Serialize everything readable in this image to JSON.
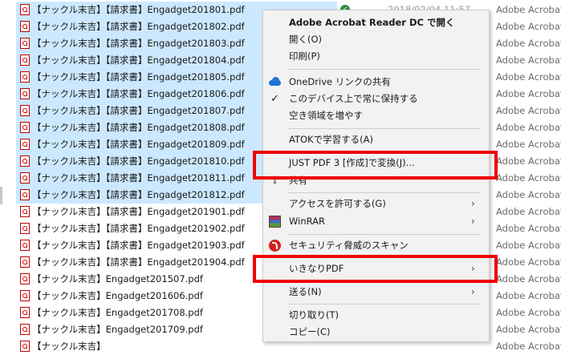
{
  "files": [
    {
      "name": "【ナックル末吉】【請求書】Engadget201801.pdf",
      "selected": true,
      "date": "2018/02/04 11:57",
      "synced": true,
      "type": "Adobe Acrobat D..."
    },
    {
      "name": "【ナックル末吉】【請求書】Engadget201802.pdf",
      "selected": true,
      "type": "Adobe Acrobat D..."
    },
    {
      "name": "【ナックル末吉】【請求書】Engadget201803.pdf",
      "selected": true,
      "type": "Adobe Acrobat D..."
    },
    {
      "name": "【ナックル末吉】【請求書】Engadget201804.pdf",
      "selected": true,
      "type": "Adobe Acrobat D..."
    },
    {
      "name": "【ナックル末吉】【請求書】Engadget201805.pdf",
      "selected": true,
      "type": "Adobe Acrobat D..."
    },
    {
      "name": "【ナックル末吉】【請求書】Engadget201806.pdf",
      "selected": true,
      "type": "Adobe Acrobat D..."
    },
    {
      "name": "【ナックル末吉】【請求書】Engadget201807.pdf",
      "selected": true,
      "type": "Adobe Acrobat D..."
    },
    {
      "name": "【ナックル末吉】【請求書】Engadget201808.pdf",
      "selected": true,
      "type": "Adobe Acrobat D..."
    },
    {
      "name": "【ナックル末吉】【請求書】Engadget201809.pdf",
      "selected": true,
      "type": "Adobe Acrobat D..."
    },
    {
      "name": "【ナックル末吉】【請求書】Engadget201810.pdf",
      "selected": true,
      "type": "Adobe Acrobat D..."
    },
    {
      "name": "【ナックル末吉】【請求書】Engadget201811.pdf",
      "selected": true,
      "type": "Adobe Acrobat D..."
    },
    {
      "name": "【ナックル末吉】【請求書】Engadget201812.pdf",
      "selected": true,
      "type": "Adobe Acrobat D..."
    },
    {
      "name": "【ナックル末吉】【請求書】Engadget201901.pdf",
      "selected": false,
      "type": "Adobe Acrobat D..."
    },
    {
      "name": "【ナックル末吉】【請求書】Engadget201902.pdf",
      "selected": false,
      "type": "Adobe Acrobat D..."
    },
    {
      "name": "【ナックル末吉】【請求書】Engadget201903.pdf",
      "selected": false,
      "type": "Adobe Acrobat D..."
    },
    {
      "name": "【ナックル末吉】【請求書】Engadget201904.pdf",
      "selected": false,
      "type": "Adobe Acrobat D..."
    },
    {
      "name": "【ナックル末吉】Engadget201507.pdf",
      "selected": false,
      "type": "Adobe Acrobat D..."
    },
    {
      "name": "【ナックル末吉】Engadget201606.pdf",
      "selected": false,
      "type": "Adobe Acrobat D..."
    },
    {
      "name": "【ナックル末吉】Engadget201708.pdf",
      "selected": false,
      "type": "Adobe Acrobat D..."
    },
    {
      "name": "【ナックル末吉】Engadget201709.pdf",
      "selected": false,
      "type": "Adobe Acrobat D..."
    },
    {
      "name": "【ナックル末吉】",
      "selected": false,
      "type": "Adobe Acrobat D..."
    }
  ],
  "context_menu": {
    "open_with_acrobat": "Adobe Acrobat Reader DC で開く",
    "open": "開く(O)",
    "print": "印刷(P)",
    "onedrive_share": "OneDrive リンクの共有",
    "keep_on_device": "このデバイス上で常に保持する",
    "free_up_space": "空き領域を増やす",
    "atok_learn": "ATOKで学習する(A)",
    "just_pdf_convert": "JUST PDF 3 [作成]で変換(J)...",
    "share": "共有",
    "give_access": "アクセスを許可する(G)",
    "winrar": "WinRAR",
    "security_scan": "セキュリティ脅威のスキャン",
    "ikinari_pdf": "いきなりPDF",
    "send_to": "送る(N)",
    "cut": "切り取り(T)",
    "copy": "コピー(C)",
    "submenu_arrow": "›",
    "check_glyph": "✓",
    "share_glyph": "⇪"
  },
  "icons": {
    "pdf": "pdf-file-icon",
    "sync_status": "sync-check-icon",
    "onedrive": "cloud-icon",
    "winrar": "winrar-icon",
    "security": "security-icon"
  },
  "colors": {
    "selection": "#cce8ff",
    "highlight_box": "#ee0000",
    "menu_background": "#f2f2f2"
  }
}
